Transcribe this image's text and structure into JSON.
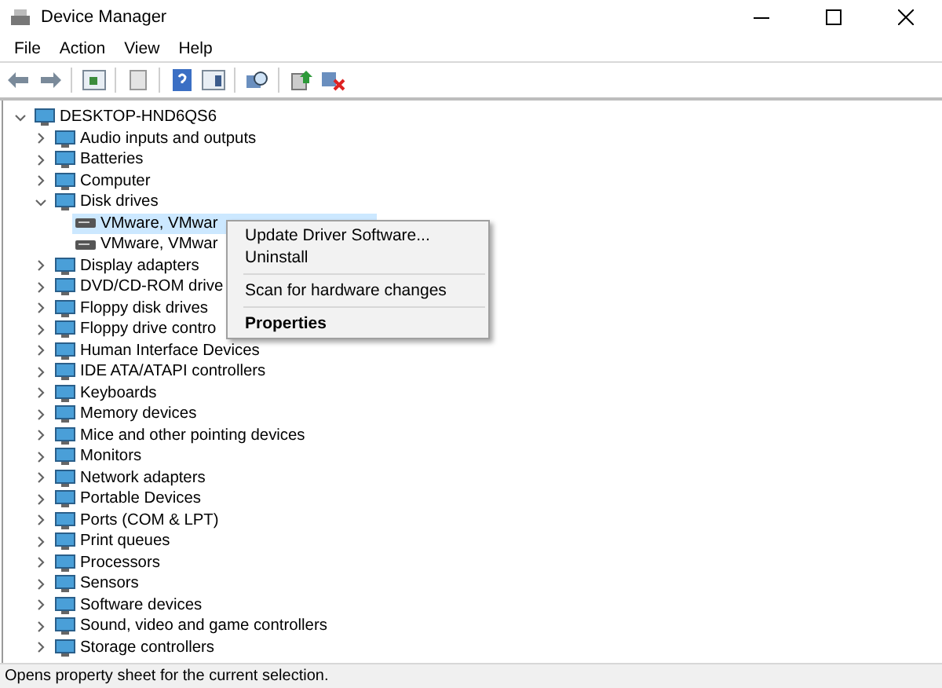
{
  "window": {
    "title": "Device Manager"
  },
  "menu_bar": [
    "File",
    "Action",
    "View",
    "Help"
  ],
  "tree": {
    "label": "DESKTOP-HND6QS6",
    "expanded": true,
    "selected": false,
    "children": [
      {
        "label": "Audio inputs and outputs",
        "expanded": false,
        "selected": false
      },
      {
        "label": "Batteries",
        "expanded": false,
        "selected": false
      },
      {
        "label": "Computer",
        "expanded": false,
        "selected": false
      },
      {
        "label": "Disk drives",
        "expanded": true,
        "selected": false,
        "children": [
          {
            "label": "VMware, VMwar",
            "selected": true
          },
          {
            "label": "VMware, VMwar",
            "selected": false
          }
        ]
      },
      {
        "label": "Display adapters",
        "expanded": false,
        "selected": false
      },
      {
        "label": "DVD/CD-ROM drive",
        "expanded": false,
        "selected": false
      },
      {
        "label": "Floppy disk drives",
        "expanded": false,
        "selected": false
      },
      {
        "label": "Floppy drive contro",
        "expanded": false,
        "selected": false
      },
      {
        "label": "Human Interface Devices",
        "expanded": false,
        "selected": false
      },
      {
        "label": "IDE ATA/ATAPI controllers",
        "expanded": false,
        "selected": false
      },
      {
        "label": "Keyboards",
        "expanded": false,
        "selected": false
      },
      {
        "label": "Memory devices",
        "expanded": false,
        "selected": false
      },
      {
        "label": "Mice and other pointing devices",
        "expanded": false,
        "selected": false
      },
      {
        "label": "Monitors",
        "expanded": false,
        "selected": false
      },
      {
        "label": "Network adapters",
        "expanded": false,
        "selected": false
      },
      {
        "label": "Portable Devices",
        "expanded": false,
        "selected": false
      },
      {
        "label": "Ports (COM & LPT)",
        "expanded": false,
        "selected": false
      },
      {
        "label": "Print queues",
        "expanded": false,
        "selected": false
      },
      {
        "label": "Processors",
        "expanded": false,
        "selected": false
      },
      {
        "label": "Sensors",
        "expanded": false,
        "selected": false
      },
      {
        "label": "Software devices",
        "expanded": false,
        "selected": false
      },
      {
        "label": "Sound, video and game controllers",
        "expanded": false,
        "selected": false
      },
      {
        "label": "Storage controllers",
        "expanded": false,
        "selected": false
      }
    ]
  },
  "context_menu": [
    {
      "kind": "item",
      "label": "Update Driver Software...",
      "default": false
    },
    {
      "kind": "item",
      "label": "Uninstall",
      "default": false
    },
    {
      "kind": "separator"
    },
    {
      "kind": "item",
      "label": "Scan for hardware changes",
      "default": false
    },
    {
      "kind": "separator"
    },
    {
      "kind": "item",
      "label": "Properties",
      "default": true
    }
  ],
  "status_bar": "Opens property sheet for the current selection."
}
